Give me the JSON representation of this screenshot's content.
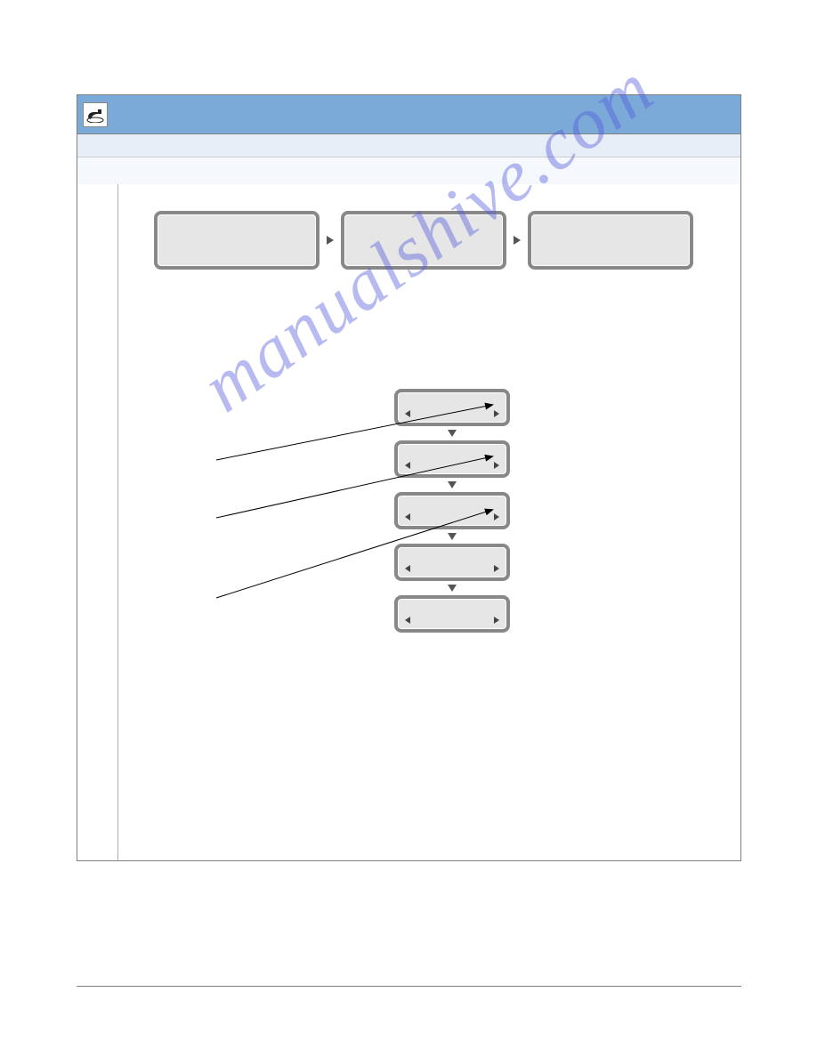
{
  "header": {
    "icon": "phone-icon"
  },
  "watermark": "manualshive.com",
  "flow": {
    "row_boxes": [
      "",
      "",
      ""
    ],
    "stack_boxes": [
      "",
      "",
      "",
      "",
      ""
    ]
  }
}
